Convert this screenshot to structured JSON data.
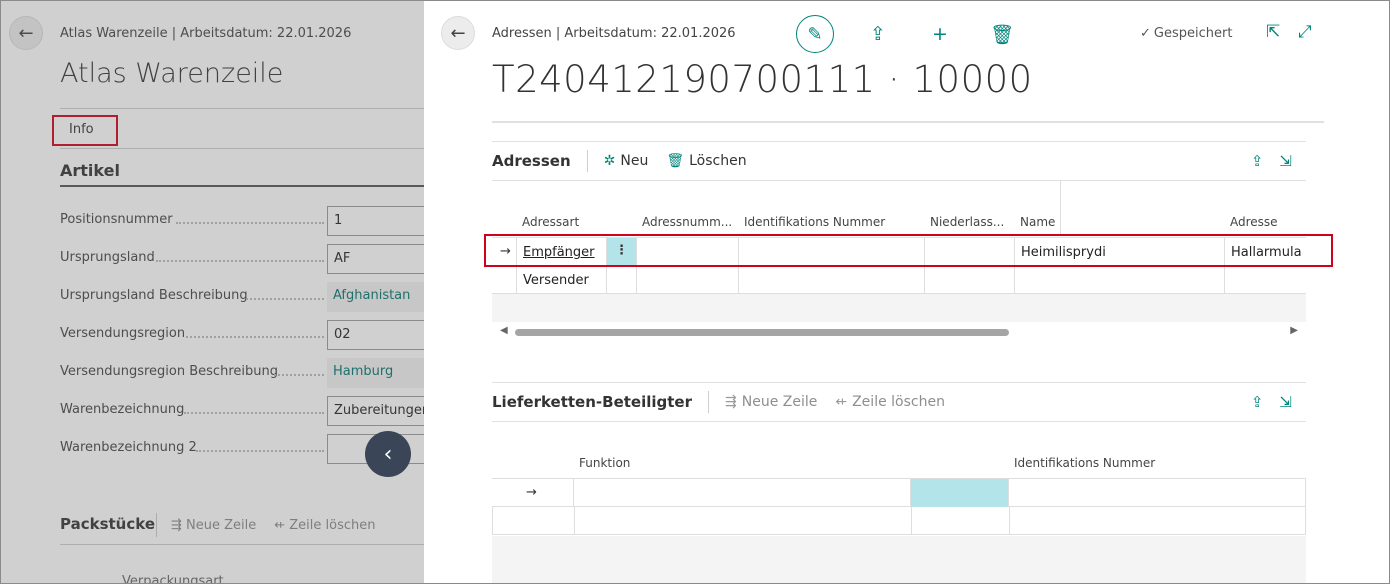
{
  "background": {
    "breadcrumb": "Atlas Warenzeile | Arbeitsdatum: 22.01.2026",
    "title": "Atlas Warenzeile",
    "tab_info": "Info",
    "section_artikel": "Artikel",
    "fields": [
      {
        "label": "Positionsnummer",
        "value": "1",
        "readonly": false
      },
      {
        "label": "Ursprungsland",
        "value": "AF",
        "readonly": false
      },
      {
        "label": "Ursprungsland Beschreibung",
        "value": "Afghanistan",
        "readonly": true
      },
      {
        "label": "Versendungsregion",
        "value": "02",
        "readonly": false
      },
      {
        "label": "Versendungsregion Beschreibung",
        "value": "Hamburg",
        "readonly": true
      },
      {
        "label": "Warenbezeichnung",
        "value": "Zubereitungen",
        "readonly": false
      },
      {
        "label": "Warenbezeichnung 2",
        "value": "",
        "readonly": false
      }
    ],
    "section_packstuecke": "Packstücke",
    "pack_actions": {
      "new_line": "Neue Zeile",
      "delete_line": "Zeile löschen"
    },
    "footer_text": "Verpackungsart"
  },
  "panel": {
    "breadcrumb": "Adressen | Arbeitsdatum: 22.01.2026",
    "saved_label": "Gespeichert",
    "title": "T240412190700111 · 10000",
    "adressen": {
      "title": "Adressen",
      "action_new": "Neu",
      "action_delete": "Löschen",
      "columns": [
        "Adressart",
        "Adressnumm...",
        "Identifikations Nummer",
        "Niederlass...",
        "Name",
        "Adresse"
      ],
      "rows": [
        {
          "adressart": "Empfänger",
          "adressnummer": "",
          "identifikation": "",
          "niederlassung": "",
          "name": "Heimilisprydi",
          "adresse": "Hallarmula"
        },
        {
          "adressart": "Versender",
          "adressnummer": "",
          "identifikation": "",
          "niederlassung": "",
          "name": "",
          "adresse": ""
        }
      ],
      "more_glyph": "⋮"
    },
    "lieferketten": {
      "title": "Lieferketten-Beteiligter",
      "action_new": "Neue Zeile",
      "action_delete": "Zeile löschen",
      "columns": [
        "Funktion",
        "Identifikations Nummer"
      ]
    }
  },
  "icons": [
    "back-arrow-icon",
    "edit-pencil-icon",
    "share-icon",
    "plus-icon",
    "trash-icon",
    "checkmark-icon",
    "open-new-window-icon",
    "expand-icon",
    "new-sparkle-icon",
    "row-arrow-icon",
    "more-options-icon",
    "collapse-panel-icon"
  ],
  "colors": {
    "accent": "#00857a",
    "highlight": "#d0021b",
    "selected_cell": "#b3e4ea",
    "nav_button": "#3a4658"
  }
}
